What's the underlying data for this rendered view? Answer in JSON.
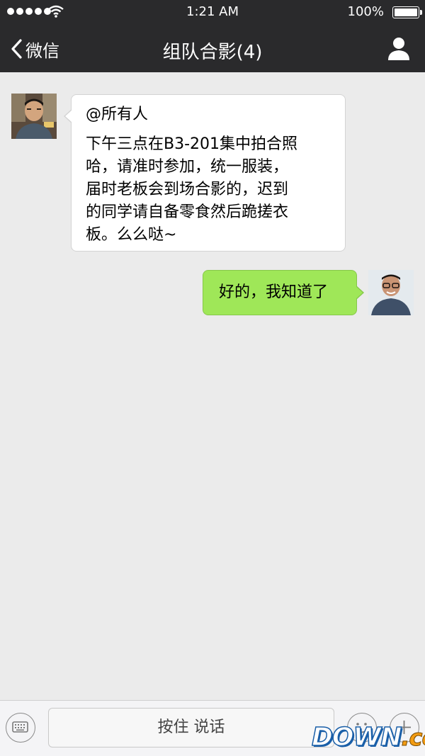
{
  "status_bar": {
    "time": "1:21 AM",
    "battery": "100%",
    "signal_icon": "signal-dots-icon",
    "wifi_icon": "wifi-icon"
  },
  "nav": {
    "back_label": "微信",
    "title": "组队合影(4)",
    "profile_icon": "person-icon"
  },
  "messages": [
    {
      "direction": "incoming",
      "mention": "@所有人",
      "lines": [
        "下午三点在B3-201集中拍合照",
        "哈，请准时参加，统一服装，",
        "届时老板会到场合影的，迟到",
        "的同学请自备零食然后跪搓衣",
        "板。么么哒~"
      ]
    },
    {
      "direction": "outgoing",
      "text": "好的，我知道了"
    }
  ],
  "input_bar": {
    "hold_to_talk": "按住 说话",
    "keyboard_icon": "keyboard-icon",
    "emoji_icon": "emoji-icon",
    "plus_icon": "plus-icon"
  },
  "watermark": {
    "part1": "DOWN",
    "part2": ".cc"
  },
  "colors": {
    "navbar": "#2a2a2c",
    "chat_bg": "#ebebeb",
    "outgoing_bubble": "#9fe758",
    "incoming_bubble": "#ffffff"
  }
}
